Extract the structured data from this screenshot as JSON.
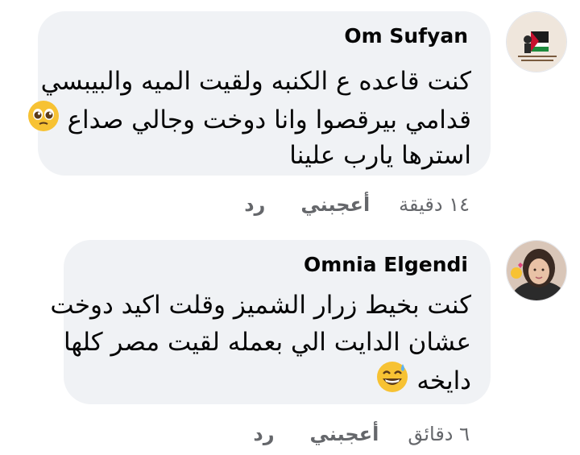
{
  "comments": [
    {
      "author": "Om Sufyan",
      "lines": [
        "كنت قاعده ع الكنبه ولقيت الميه والبيبسي",
        "قدامي بيرقصوا وانا دوخت وجالي صداع",
        "استرها يارب علينا"
      ],
      "emoji": "pleading-face-icon",
      "time": "١٤ دقيقة",
      "like_label": "أعجبني",
      "reply_label": "رد"
    },
    {
      "author": "Omnia Elgendi",
      "lines": [
        "كنت بخيط زرار الشميز وقلت اكيد دوخت",
        "عشان الدايت الي بعمله لقيت مصر كلها",
        "دايخه"
      ],
      "emoji": "grinning-sweat-face-icon",
      "time": "٦ دقائق",
      "like_label": "أعجبني",
      "reply_label": "رد"
    }
  ],
  "colors": {
    "bubble": "#f0f2f5",
    "text": "#050505",
    "meta": "#65676b",
    "emoji_yellow": "#f7c233"
  }
}
